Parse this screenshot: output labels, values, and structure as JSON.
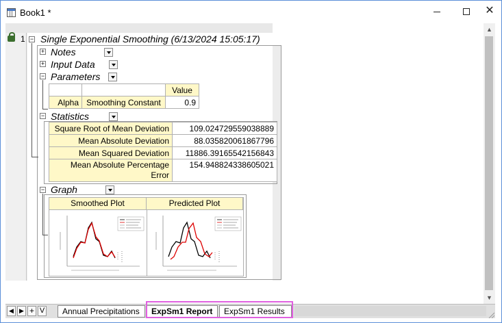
{
  "window": {
    "title": "Book1 *"
  },
  "report": {
    "row_number": "1",
    "title": "Single Exponential Smoothing (6/13/2024 15:05:17)",
    "sections": {
      "notes": "Notes",
      "input_data": "Input Data",
      "parameters": "Parameters",
      "statistics": "Statistics",
      "graph": "Graph"
    },
    "parameters_table": {
      "header": "Value",
      "rows": [
        {
          "name": "Alpha",
          "label": "Smoothing Constant",
          "value": "0.9"
        }
      ]
    },
    "statistics_table": {
      "rows": [
        {
          "label": "Square Root of Mean Deviation",
          "value": "109.024729559038889"
        },
        {
          "label": "Mean Absolute Deviation",
          "value": "88.035820061867796"
        },
        {
          "label": "Mean Squared Deviation",
          "value": "11886.39165542156843"
        },
        {
          "label": "Mean Absolute Percentage Error",
          "value": "154.948824338605021"
        }
      ]
    },
    "graph_table": {
      "headers": [
        "Smoothed Plot",
        "Predicted Plot"
      ]
    }
  },
  "tabs": {
    "items": [
      "Annual Precipitations",
      "ExpSm1 Report",
      "ExpSm1 Results"
    ],
    "active": "ExpSm1 Report"
  },
  "colors": {
    "accent": "#5b8fd8",
    "header_fill": "#fff8c8",
    "highlight": "#e060e0"
  }
}
